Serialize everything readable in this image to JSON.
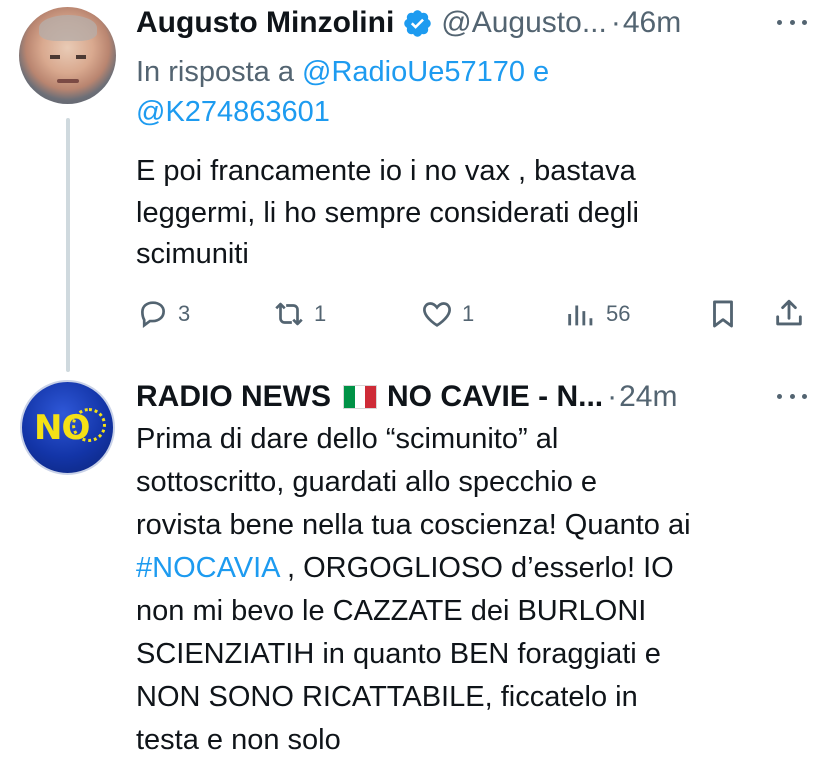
{
  "tweet_1": {
    "name": "Augusto Minzolini",
    "handle": "@Augusto...",
    "dot": "·",
    "time": "46m",
    "reply_prefix": "In risposta a",
    "reply_mention_1": "@RadioUe57170",
    "reply_and": "e",
    "reply_mention_2": "@K274863601",
    "text": "E poi francamente io i no vax , bastava\nleggermi, li ho sempre considerati degli\nscimuniti",
    "actions": {
      "replies": "3",
      "retweets": "1",
      "likes": "1",
      "views": "56"
    }
  },
  "tweet_2": {
    "name_part_1": "RADIO NEWS",
    "name_part_2": "NO CAVIE - N...",
    "dot": "·",
    "time": "24m",
    "avatar_text": "NO",
    "text_before_hashtag": "Prima di dare dello “scimunito” al\nsottoscritto, guardati allo specchio e\nrovista bene nella tua coscienza!  Quanto ai\n",
    "hashtag": "#NOCAVIA",
    "text_after_hashtag": " , ORGOGLIOSO d’esserlo! IO\nnon mi bevo le CAZZATE dei BURLONI\nSCIENZIATIH in quanto BEN foraggiati e\nNON SONO RICATTABILE, ficcatelo in\ntesta e non solo"
  },
  "colors": {
    "link": "#1d9bf0",
    "secondary_text": "#536471",
    "verified": "#1d9bf0",
    "thread_line": "#cfd9de"
  },
  "icons": [
    "reply-icon",
    "retweet-icon",
    "like-icon",
    "views-icon",
    "bookmark-icon",
    "share-icon",
    "verified-badge-icon",
    "more-icon",
    "italian-flag-icon"
  ]
}
